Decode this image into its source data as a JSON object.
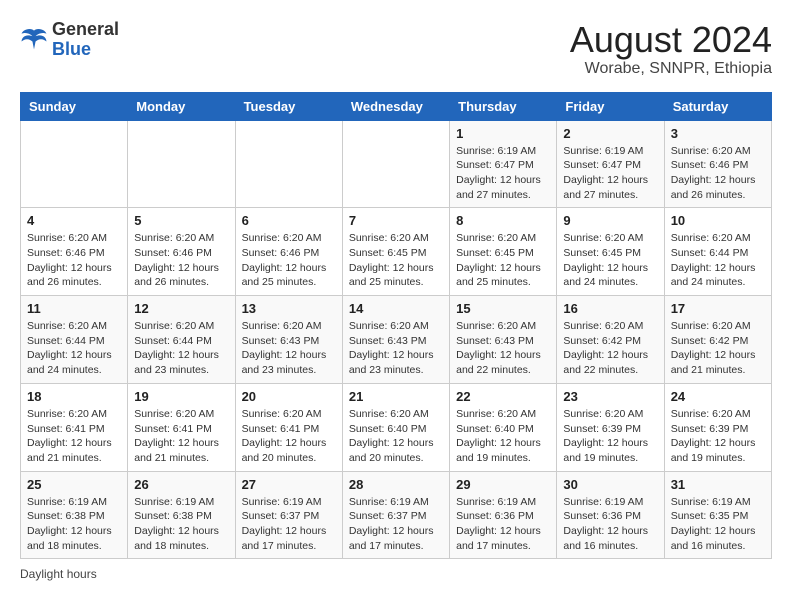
{
  "header": {
    "logo_general": "General",
    "logo_blue": "Blue",
    "month_title": "August 2024",
    "location": "Worabe, SNNPR, Ethiopia"
  },
  "weekdays": [
    "Sunday",
    "Monday",
    "Tuesday",
    "Wednesday",
    "Thursday",
    "Friday",
    "Saturday"
  ],
  "weeks": [
    [
      {
        "day": "",
        "info": ""
      },
      {
        "day": "",
        "info": ""
      },
      {
        "day": "",
        "info": ""
      },
      {
        "day": "",
        "info": ""
      },
      {
        "day": "1",
        "info": "Sunrise: 6:19 AM\nSunset: 6:47 PM\nDaylight: 12 hours and 27 minutes."
      },
      {
        "day": "2",
        "info": "Sunrise: 6:19 AM\nSunset: 6:47 PM\nDaylight: 12 hours and 27 minutes."
      },
      {
        "day": "3",
        "info": "Sunrise: 6:20 AM\nSunset: 6:46 PM\nDaylight: 12 hours and 26 minutes."
      }
    ],
    [
      {
        "day": "4",
        "info": "Sunrise: 6:20 AM\nSunset: 6:46 PM\nDaylight: 12 hours and 26 minutes."
      },
      {
        "day": "5",
        "info": "Sunrise: 6:20 AM\nSunset: 6:46 PM\nDaylight: 12 hours and 26 minutes."
      },
      {
        "day": "6",
        "info": "Sunrise: 6:20 AM\nSunset: 6:46 PM\nDaylight: 12 hours and 25 minutes."
      },
      {
        "day": "7",
        "info": "Sunrise: 6:20 AM\nSunset: 6:45 PM\nDaylight: 12 hours and 25 minutes."
      },
      {
        "day": "8",
        "info": "Sunrise: 6:20 AM\nSunset: 6:45 PM\nDaylight: 12 hours and 25 minutes."
      },
      {
        "day": "9",
        "info": "Sunrise: 6:20 AM\nSunset: 6:45 PM\nDaylight: 12 hours and 24 minutes."
      },
      {
        "day": "10",
        "info": "Sunrise: 6:20 AM\nSunset: 6:44 PM\nDaylight: 12 hours and 24 minutes."
      }
    ],
    [
      {
        "day": "11",
        "info": "Sunrise: 6:20 AM\nSunset: 6:44 PM\nDaylight: 12 hours and 24 minutes."
      },
      {
        "day": "12",
        "info": "Sunrise: 6:20 AM\nSunset: 6:44 PM\nDaylight: 12 hours and 23 minutes."
      },
      {
        "day": "13",
        "info": "Sunrise: 6:20 AM\nSunset: 6:43 PM\nDaylight: 12 hours and 23 minutes."
      },
      {
        "day": "14",
        "info": "Sunrise: 6:20 AM\nSunset: 6:43 PM\nDaylight: 12 hours and 23 minutes."
      },
      {
        "day": "15",
        "info": "Sunrise: 6:20 AM\nSunset: 6:43 PM\nDaylight: 12 hours and 22 minutes."
      },
      {
        "day": "16",
        "info": "Sunrise: 6:20 AM\nSunset: 6:42 PM\nDaylight: 12 hours and 22 minutes."
      },
      {
        "day": "17",
        "info": "Sunrise: 6:20 AM\nSunset: 6:42 PM\nDaylight: 12 hours and 21 minutes."
      }
    ],
    [
      {
        "day": "18",
        "info": "Sunrise: 6:20 AM\nSunset: 6:41 PM\nDaylight: 12 hours and 21 minutes."
      },
      {
        "day": "19",
        "info": "Sunrise: 6:20 AM\nSunset: 6:41 PM\nDaylight: 12 hours and 21 minutes."
      },
      {
        "day": "20",
        "info": "Sunrise: 6:20 AM\nSunset: 6:41 PM\nDaylight: 12 hours and 20 minutes."
      },
      {
        "day": "21",
        "info": "Sunrise: 6:20 AM\nSunset: 6:40 PM\nDaylight: 12 hours and 20 minutes."
      },
      {
        "day": "22",
        "info": "Sunrise: 6:20 AM\nSunset: 6:40 PM\nDaylight: 12 hours and 19 minutes."
      },
      {
        "day": "23",
        "info": "Sunrise: 6:20 AM\nSunset: 6:39 PM\nDaylight: 12 hours and 19 minutes."
      },
      {
        "day": "24",
        "info": "Sunrise: 6:20 AM\nSunset: 6:39 PM\nDaylight: 12 hours and 19 minutes."
      }
    ],
    [
      {
        "day": "25",
        "info": "Sunrise: 6:19 AM\nSunset: 6:38 PM\nDaylight: 12 hours and 18 minutes."
      },
      {
        "day": "26",
        "info": "Sunrise: 6:19 AM\nSunset: 6:38 PM\nDaylight: 12 hours and 18 minutes."
      },
      {
        "day": "27",
        "info": "Sunrise: 6:19 AM\nSunset: 6:37 PM\nDaylight: 12 hours and 17 minutes."
      },
      {
        "day": "28",
        "info": "Sunrise: 6:19 AM\nSunset: 6:37 PM\nDaylight: 12 hours and 17 minutes."
      },
      {
        "day": "29",
        "info": "Sunrise: 6:19 AM\nSunset: 6:36 PM\nDaylight: 12 hours and 17 minutes."
      },
      {
        "day": "30",
        "info": "Sunrise: 6:19 AM\nSunset: 6:36 PM\nDaylight: 12 hours and 16 minutes."
      },
      {
        "day": "31",
        "info": "Sunrise: 6:19 AM\nSunset: 6:35 PM\nDaylight: 12 hours and 16 minutes."
      }
    ]
  ],
  "footer": {
    "daylight_label": "Daylight hours"
  }
}
